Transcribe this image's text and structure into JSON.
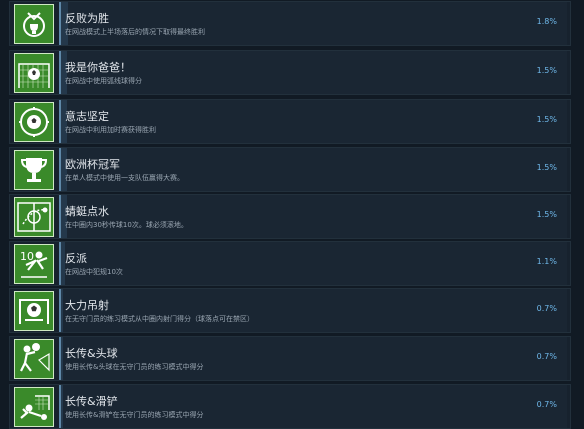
{
  "achievements": [
    {
      "title": "反败为胜",
      "description": "在网战模式上半场落后的情况下取得最终胜利",
      "percent": "1.8%",
      "icon": "trophy-medal-icon",
      "fill": 0.018
    },
    {
      "title": "我是你爸爸！",
      "description": "在网战中使用弧线球得分",
      "percent": "1.5%",
      "icon": "ball-goal-net-icon",
      "fill": 0.015
    },
    {
      "title": "意志坚定",
      "description": "在网战中利用加时赛获得胜利",
      "percent": "1.5%",
      "icon": "ball-clock-icon",
      "fill": 0.015
    },
    {
      "title": "欧洲杯冠军",
      "description": "在单人模式中使用一支队伍赢得大赛。",
      "percent": "1.5%",
      "icon": "cup-trophy-icon",
      "fill": 0.015
    },
    {
      "title": "蜻蜓点水",
      "description": "在中圈内30秒传球10次。球必须滚地。",
      "percent": "1.5%",
      "icon": "pitch-pass-icon",
      "fill": 0.015
    },
    {
      "title": "反派",
      "description": "在网战中犯规10次",
      "percent": "1.1%",
      "icon": "player-foul-icon",
      "fill": 0.011
    },
    {
      "title": "大力吊射",
      "description": "在无守门员的练习模式从中圈内射门得分（球落点可在禁区）",
      "percent": "0.7%",
      "icon": "ball-goal-icon",
      "fill": 0.007
    },
    {
      "title": "长传&头球",
      "description": "使用长传&头球在无守门员的练习模式中得分",
      "percent": "0.7%",
      "icon": "header-player-icon",
      "fill": 0.007
    },
    {
      "title": "长传&滑铲",
      "description": "使用长传&滑铲在无守门员的练习模式中得分",
      "percent": "0.7%",
      "icon": "slide-tackle-icon",
      "fill": 0.007
    }
  ],
  "colors": {
    "background": "#111a24",
    "row": "#17222e",
    "icon_green": "#3a8a2a",
    "percent": "#6fb8ea"
  }
}
